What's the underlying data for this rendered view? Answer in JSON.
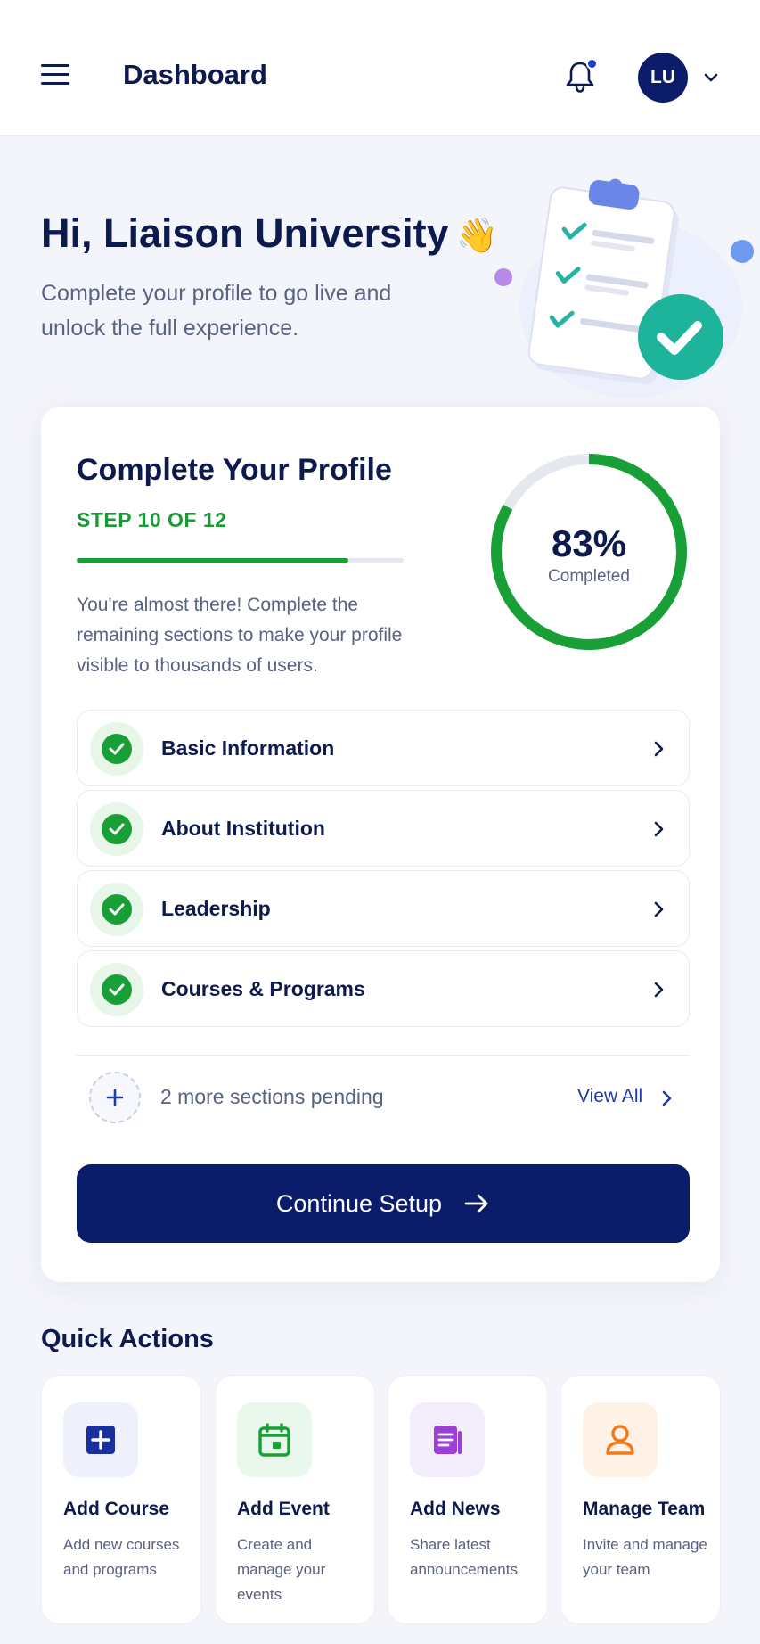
{
  "header": {
    "title": "Dashboard",
    "avatar_initials": "LU",
    "icons": [
      "menu-icon",
      "bell-icon",
      "chevron-down-icon"
    ],
    "has_notification_dot": true
  },
  "greeting": {
    "title": "Hi, Liaison University",
    "emoji": "👋",
    "subtitle": "Complete your profile to go live and unlock the full experience."
  },
  "profile_card": {
    "title": "Complete Your Profile",
    "step_label": "STEP 10 OF 12",
    "step_progress": 0.83,
    "description": "You're almost there! Complete the remaining sections to make your profile visible to thousands of users.",
    "completion_percent": "83%",
    "completion_value": 83,
    "completion_label": "Completed",
    "sections": [
      {
        "label": "Basic Information",
        "status": "complete"
      },
      {
        "label": "About Institution",
        "status": "complete"
      },
      {
        "label": "Leadership",
        "status": "complete"
      },
      {
        "label": "Courses & Programs",
        "status": "complete"
      }
    ],
    "pending_text": "2 more sections pending",
    "view_all_label": "View All",
    "continue_label": "Continue Setup"
  },
  "quick_actions": {
    "title": "Quick Actions",
    "items": [
      {
        "name": "Add Course",
        "desc": "Add new courses and programs",
        "icon": "plus-square-icon",
        "color": "#1a2f9e",
        "bg": "#eef0fc"
      },
      {
        "name": "Add Event",
        "desc": "Create and manage your events",
        "icon": "calendar-icon",
        "color": "#18a036",
        "bg": "#eaf7ec"
      },
      {
        "name": "Add News",
        "desc": "Share latest announcements",
        "icon": "newspaper-icon",
        "color": "#9b3fd6",
        "bg": "#f3ecfb"
      },
      {
        "name": "Manage Team",
        "desc": "Invite and manage your team",
        "icon": "user-icon",
        "color": "#f07a1a",
        "bg": "#fef1e6"
      }
    ]
  },
  "colors": {
    "primary_navy": "#0b1c6b",
    "success_green": "#18a036",
    "background": "#f4f5fb"
  }
}
